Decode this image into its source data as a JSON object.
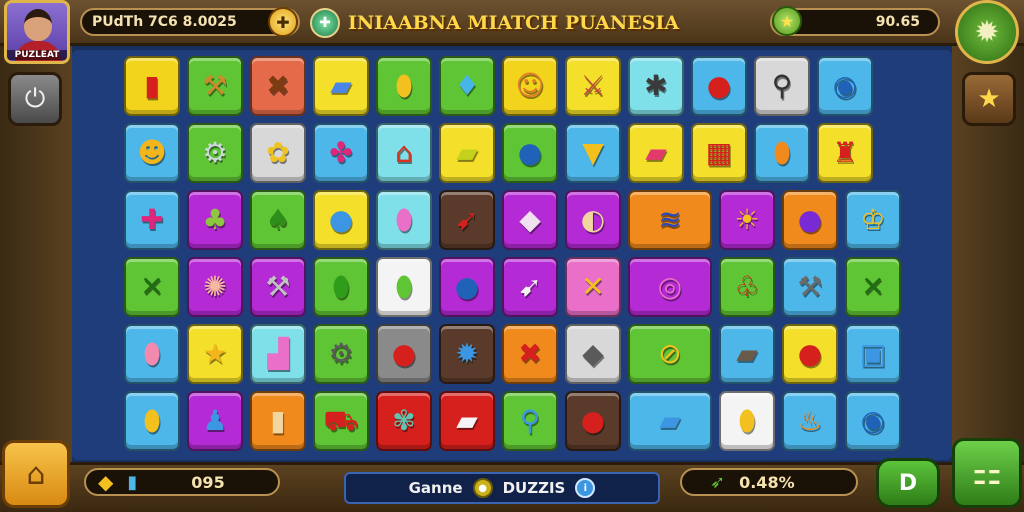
{
  "header": {
    "player_name": "PUZLEAT",
    "score_text": "PUdTh 7C6 8.0025",
    "title": "INIAABNA MIATCH PUANESIA",
    "right_value": "90.65"
  },
  "footer": {
    "gem_value": "095",
    "mode_left": "Ganne",
    "mode_right": "DUZZIS",
    "percent_value": "0.48%",
    "play_label": "D"
  },
  "icons": {
    "score_add": "plus-coin-icon",
    "title_badge": "crest-icon",
    "star": "star-icon",
    "settings": "gear-icon",
    "left_side": "power-icon",
    "right_side": "star-icon",
    "home": "home-icon",
    "gem": "diamond-icon",
    "potion": "bottle-icon",
    "menu": "grid-menu-icon",
    "rocket": "rocket-icon"
  },
  "colors": {
    "board": "#1f3d7a",
    "title": "#ffd84a",
    "wood": "#5a4121"
  },
  "board": {
    "rows": [
      [
        {
          "bg": "#f2d41c",
          "icon": "▮",
          "fg": "#d6201d",
          "name": "red-capsule"
        },
        {
          "bg": "#5fc535",
          "icon": "⚒",
          "fg": "#c98b2b",
          "name": "hammer"
        },
        {
          "bg": "#e46a4a",
          "icon": "✖",
          "fg": "#7d3b12",
          "name": "crossed-sticks"
        },
        {
          "bg": "#f4e02a",
          "icon": "▰",
          "fg": "#4a86e8",
          "name": "blue-bar"
        },
        {
          "bg": "#5fc535",
          "icon": "⬮",
          "fg": "#f2c01f",
          "name": "yellow-drop"
        },
        {
          "bg": "#5fc535",
          "icon": "♦",
          "fg": "#46b6e8",
          "name": "blue-bell"
        },
        {
          "bg": "#f2d41c",
          "icon": "☺",
          "fg": "#e37b2c",
          "name": "orange-face"
        },
        {
          "bg": "#f4e02a",
          "icon": "⚔",
          "fg": "#c44b3b",
          "name": "hammer-tool"
        },
        {
          "bg": "#7fe0ea",
          "icon": "✱",
          "fg": "#3a3a3a",
          "name": "spider"
        },
        {
          "bg": "#4eb7ea",
          "icon": "●",
          "fg": "#d6201d",
          "name": "red-ball"
        },
        {
          "bg": "#d8d8d8",
          "icon": "⚲",
          "fg": "#333333",
          "name": "microphone"
        },
        {
          "bg": "#4eb7ea",
          "icon": "◉",
          "fg": "#1f62b8",
          "name": "blue-orb"
        }
      ],
      [
        {
          "bg": "#4eb7ea",
          "icon": "☻",
          "fg": "#f2b61c",
          "name": "hard-hat-face"
        },
        {
          "bg": "#5fc535",
          "icon": "⚙",
          "fg": "#cfd6dd",
          "name": "robot-head"
        },
        {
          "bg": "#d8d8d8",
          "icon": "✿",
          "fg": "#f0c420",
          "name": "candy"
        },
        {
          "bg": "#4eb7ea",
          "icon": "✤",
          "fg": "#e0267a",
          "name": "pink-star"
        },
        {
          "bg": "#7fe0ea",
          "icon": "⌂",
          "fg": "#d8321e",
          "name": "red-camera"
        },
        {
          "bg": "#f4e02a",
          "icon": "▰",
          "fg": "#c4d21c",
          "name": "yellow-bar"
        },
        {
          "bg": "#5fc535",
          "icon": "●",
          "fg": "#1f62b8",
          "name": "blue-bulb"
        },
        {
          "bg": "#4eb7ea",
          "icon": "▼",
          "fg": "#f2c01f",
          "name": "yellow-funnel"
        },
        {
          "bg": "#f4e02a",
          "icon": "▰",
          "fg": "#e23a6c",
          "name": "pink-capsule"
        },
        {
          "bg": "#f4e02a",
          "icon": "▦",
          "fg": "#d6201d",
          "name": "striped-box"
        },
        {
          "bg": "#4eb7ea",
          "icon": "⬮",
          "fg": "#f08a1c",
          "name": "orange-drop"
        },
        {
          "bg": "#f4e02a",
          "icon": "♜",
          "fg": "#d6201d",
          "name": "red-totem"
        }
      ],
      [
        {
          "bg": "#4eb7ea",
          "icon": "✚",
          "fg": "#e0267a",
          "name": "pink-pin"
        },
        {
          "bg": "#b42ad4",
          "icon": "♣",
          "fg": "#8dc63f",
          "name": "green-bug"
        },
        {
          "bg": "#5fc535",
          "icon": "♠",
          "fg": "#2f8d1a",
          "name": "palm-tree"
        },
        {
          "bg": "#f4e02a",
          "icon": "●",
          "fg": "#3c96e2",
          "name": "blue-ball"
        },
        {
          "bg": "#7fe0ea",
          "icon": "⬮",
          "fg": "#ea6fc9",
          "name": "pink-gem"
        },
        {
          "bg": "#5a3a2a",
          "icon": "➹",
          "fg": "#d6201d",
          "name": "red-feather"
        },
        {
          "bg": "#b42ad4",
          "icon": "◆",
          "fg": "#f0e0f0",
          "name": "crystal"
        },
        {
          "bg": "#b42ad4",
          "icon": "◐",
          "fg": "#f2d6a0",
          "name": "shell"
        },
        {
          "bg": "#f08a1c",
          "icon": "≋",
          "fg": "#2a48b8",
          "name": "blue-berries",
          "wide": true
        },
        {
          "bg": "#b42ad4",
          "icon": "☀",
          "fg": "#f2c01f",
          "name": "sun-face"
        },
        {
          "bg": "#f08a1c",
          "icon": "●",
          "fg": "#7a2ad4",
          "name": "plum"
        },
        {
          "bg": "#4eb7ea",
          "icon": "♔",
          "fg": "#f2c01f",
          "name": "crowned-face"
        }
      ],
      [
        {
          "bg": "#5fc535",
          "icon": "✕",
          "fg": "#1f6d12",
          "name": "green-cross"
        },
        {
          "bg": "#b42ad4",
          "icon": "✺",
          "fg": "#f7b8a0",
          "name": "peach-puff"
        },
        {
          "bg": "#b42ad4",
          "icon": "⚒",
          "fg": "#c2c2c2",
          "name": "pickaxe"
        },
        {
          "bg": "#5fc535",
          "icon": "⬮",
          "fg": "#2f9d1a",
          "name": "green-drop"
        },
        {
          "bg": "#f4f4f4",
          "icon": "⬮",
          "fg": "#5fc535",
          "name": "green-leaf"
        },
        {
          "bg": "#b42ad4",
          "icon": "●",
          "fg": "#1f62b8",
          "name": "blue-potion"
        },
        {
          "bg": "#b42ad4",
          "icon": "➹",
          "fg": "#f4f4f4",
          "name": "white-feather"
        },
        {
          "bg": "#ea6fc9",
          "icon": "✕",
          "fg": "#f2c01f",
          "name": "gold-cross"
        },
        {
          "bg": "#b42ad4",
          "icon": "◎",
          "fg": "#ea6fc9",
          "name": "pink-swirl",
          "wide": true
        },
        {
          "bg": "#5fc535",
          "icon": "♧",
          "fg": "#d6201d",
          "name": "red-leaf"
        },
        {
          "bg": "#4eb7ea",
          "icon": "⚒",
          "fg": "#6a6a6a",
          "name": "gun-tool"
        },
        {
          "bg": "#5fc535",
          "icon": "✕",
          "fg": "#1f6d12",
          "name": "green-swords"
        }
      ],
      [
        {
          "bg": "#4eb7ea",
          "icon": "⬮",
          "fg": "#f28ab0",
          "name": "pink-leaf"
        },
        {
          "bg": "#f4e02a",
          "icon": "★",
          "fg": "#f2b61c",
          "name": "gold-star"
        },
        {
          "bg": "#7fe0ea",
          "icon": "▟",
          "fg": "#ea6fc9",
          "name": "pink-tool"
        },
        {
          "bg": "#5fc535",
          "icon": "⚙",
          "fg": "#5a5a5a",
          "name": "gear-bot"
        },
        {
          "bg": "#8a8a8a",
          "icon": "●",
          "fg": "#d6201d",
          "name": "red-orb"
        },
        {
          "bg": "#5a3a2a",
          "icon": "✹",
          "fg": "#3c96e2",
          "name": "blue-gear"
        },
        {
          "bg": "#f08a1c",
          "icon": "✖",
          "fg": "#d6201d",
          "name": "red-x"
        },
        {
          "bg": "#d8d8d8",
          "icon": "◆",
          "fg": "#5a5a5a",
          "name": "grey-gem"
        },
        {
          "bg": "#5fc535",
          "icon": "⊘",
          "fg": "#f2c01f",
          "name": "gold-ring",
          "wide": true
        },
        {
          "bg": "#4eb7ea",
          "icon": "▰",
          "fg": "#6a5a4a",
          "name": "log"
        },
        {
          "bg": "#f4e02a",
          "icon": "●",
          "fg": "#d6201d",
          "name": "red-apple"
        },
        {
          "bg": "#4eb7ea",
          "icon": "▣",
          "fg": "#3c96e2",
          "name": "blue-jar"
        }
      ],
      [
        {
          "bg": "#4eb7ea",
          "icon": "⬮",
          "fg": "#f2c01f",
          "name": "yellow-leaf"
        },
        {
          "bg": "#b42ad4",
          "icon": "♟",
          "fg": "#3c96e2",
          "name": "blue-figure"
        },
        {
          "bg": "#f08a1c",
          "icon": "▮",
          "fg": "#f2d6a0",
          "name": "glass-cup"
        },
        {
          "bg": "#5fc535",
          "icon": "⛟",
          "fg": "#d6201d",
          "name": "red-cart"
        },
        {
          "bg": "#d6201d",
          "icon": "✾",
          "fg": "#5fc5b0",
          "name": "teal-plant"
        },
        {
          "bg": "#d6201d",
          "icon": "▰",
          "fg": "#f4f4f4",
          "name": "white-capsule"
        },
        {
          "bg": "#5fc535",
          "icon": "⚲",
          "fg": "#3c96e2",
          "name": "blue-syringe"
        },
        {
          "bg": "#5a3a2a",
          "icon": "●",
          "fg": "#d6201d",
          "name": "red-berry"
        },
        {
          "bg": "#4eb7ea",
          "icon": "▰",
          "fg": "#3c96e2",
          "name": "blue-block",
          "wide": true
        },
        {
          "bg": "#f4f4f4",
          "icon": "⬮",
          "fg": "#f2c01f",
          "name": "gold-leaf"
        },
        {
          "bg": "#4eb7ea",
          "icon": "♨",
          "fg": "#f08a1c",
          "name": "fire-drop"
        },
        {
          "bg": "#4eb7ea",
          "icon": "◉",
          "fg": "#1f62b8",
          "name": "blue-medal"
        }
      ]
    ]
  }
}
